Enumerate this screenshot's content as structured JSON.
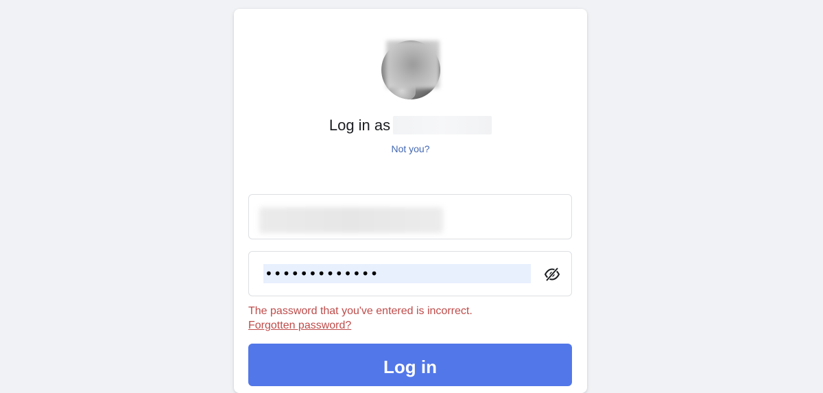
{
  "login": {
    "title_prefix": "Log in as",
    "not_you": "Not you?",
    "password_value": "•••••••••••••",
    "error_message": "The password that you've entered is incorrect.",
    "forgotten_password": "Forgotten password?",
    "login_button": "Log in"
  },
  "icons": {
    "toggle_password": "eye-slash-icon"
  },
  "colors": {
    "background": "#f0f2f5",
    "card": "#ffffff",
    "link": "#4267b2",
    "error": "#be4b49",
    "primary_button": "#5277e8",
    "autofill": "#e8f0fe"
  }
}
